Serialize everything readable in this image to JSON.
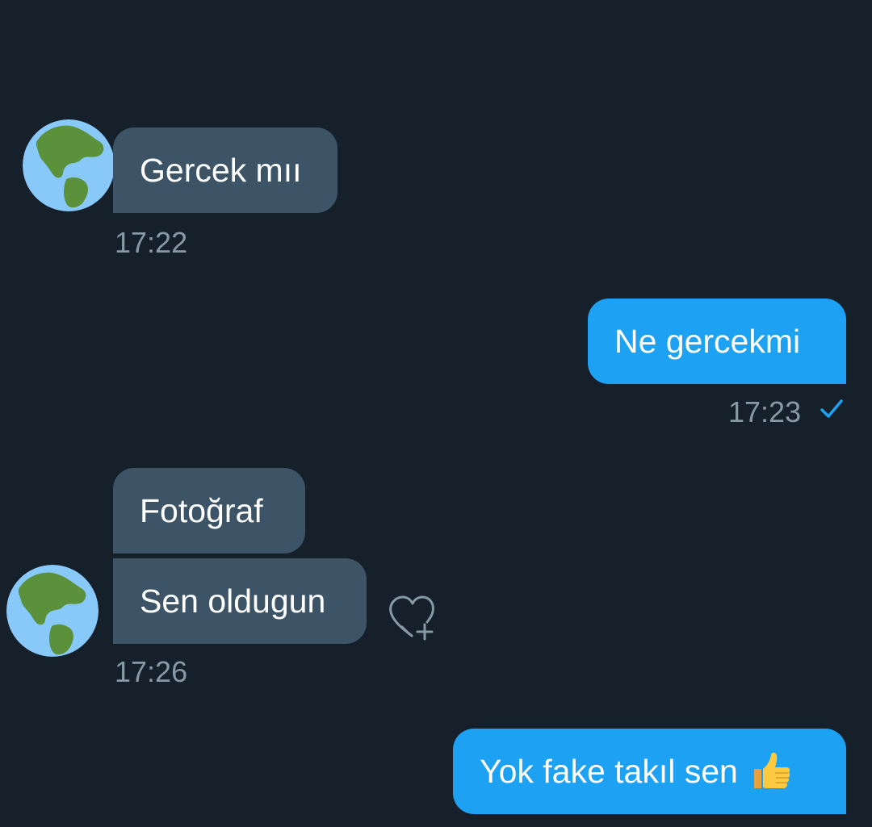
{
  "messages": [
    {
      "text": "Gercek mıı"
    },
    {
      "text": "Ne gercekmi"
    },
    {
      "text": "Fotoğraf"
    },
    {
      "text": "Sen oldugun"
    },
    {
      "text": "Yok fake takıl sen"
    }
  ],
  "timestamps": [
    "17:22",
    "17:23",
    "17:26"
  ],
  "icons": {
    "avatar": "globe-americas-icon",
    "read_receipt": "check-icon",
    "react": "heart-add-icon",
    "emoji": "thumbs-up-emoji"
  },
  "colors": {
    "background": "#15202b",
    "incoming_bubble": "#3d5466",
    "outgoing_bubble": "#1da1f2",
    "timestamp": "#8899a6",
    "check": "#1da1f2"
  }
}
